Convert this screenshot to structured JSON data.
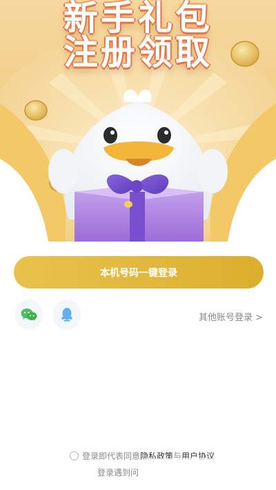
{
  "banner": {
    "line1": "新手礼包",
    "line2": "注册领取"
  },
  "login": {
    "one_click_label": "本机号码一键登录",
    "other_account_label": "其他账号登录 >"
  },
  "social": {
    "wechat_icon": "wechat-icon",
    "qq_icon": "qq-icon"
  },
  "agreement": {
    "prefix": "登录即代表同意",
    "privacy_link": "隐私政策",
    "and": "与",
    "user_link": "用户协议",
    "line2": "登录遇到问"
  },
  "colors": {
    "accent": "#dcae2d",
    "hero_bg": "#f2cf8a",
    "wechat": "#4cc15a",
    "qq": "#5fb2f0"
  }
}
